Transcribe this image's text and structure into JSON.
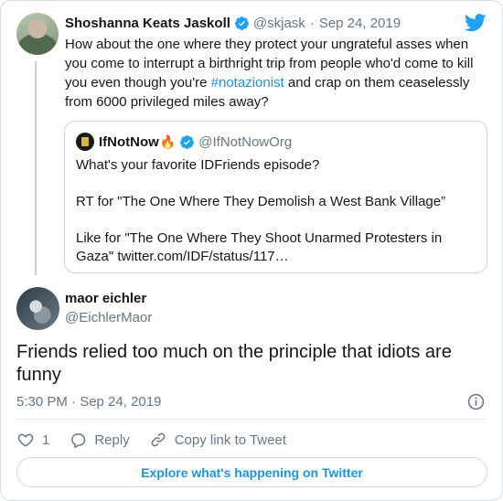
{
  "parent_tweet": {
    "name": "Shoshanna Keats Jaskoll",
    "handle": "@skjask",
    "separator": "·",
    "date": "Sep 24, 2019",
    "text_before": "How about the one where they protect your ungrateful asses when you come to interrupt a birthright trip from people who'd come to kill you even though you're ",
    "hashtag": "#notazionist",
    "text_after": " and crap on them ceaselessly from 6000 privileged miles away?"
  },
  "quoted_tweet": {
    "name": "IfNotNow",
    "emoji": "🔥",
    "handle": "@IfNotNowOrg",
    "lines": [
      "What's your favorite IDFriends episode?",
      "RT for \"The One Where They Demolish a West Bank Village”",
      "Like for \"The One Where They Shoot Unarmed Protesters in Gaza\" twitter.com/IDF/status/117…"
    ]
  },
  "main_tweet": {
    "name": "maor eichler",
    "handle": "@EichlerMaor",
    "text": "Friends relied too much on the principle that idiots are funny",
    "time": "5:30 PM · Sep 24, 2019",
    "like_count": "1",
    "reply_label": "Reply",
    "copy_link_label": "Copy link to Tweet"
  },
  "explore_label": "Explore what's happening on Twitter",
  "colors": {
    "accent": "#1b95e0",
    "text": "#14171a",
    "secondary": "#657786",
    "border": "#ccd6dd"
  },
  "icons": [
    "verified-badge-icon",
    "twitter-bird-icon",
    "info-icon",
    "heart-icon",
    "reply-bubble-icon",
    "link-icon"
  ]
}
